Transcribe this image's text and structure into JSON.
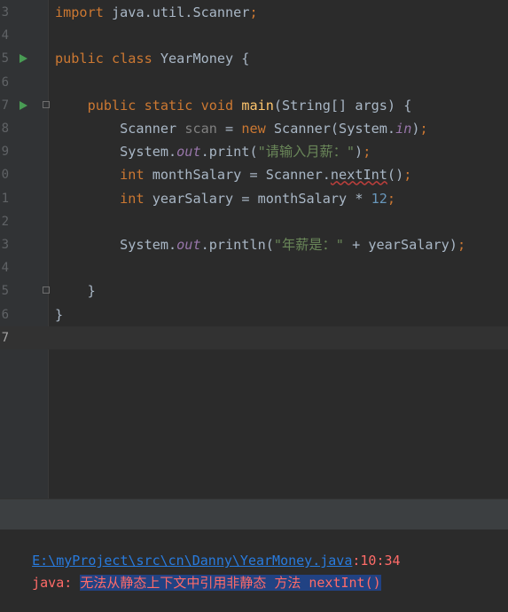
{
  "editor": {
    "lines": [
      {
        "number": "3",
        "parts": [
          [
            "kw",
            "import"
          ],
          [
            "p",
            " java.util.Scanner"
          ],
          [
            "kw",
            ";"
          ]
        ]
      },
      {
        "number": "4",
        "parts": []
      },
      {
        "number": "5",
        "run": true,
        "parts": [
          [
            "kw",
            "public class "
          ],
          [
            "p",
            "YearMoney {"
          ]
        ]
      },
      {
        "number": "6",
        "parts": []
      },
      {
        "number": "7",
        "run": true,
        "fold": true,
        "parts": [
          [
            "p",
            "    "
          ],
          [
            "kw",
            "public static void "
          ],
          [
            "fn",
            "main"
          ],
          [
            "p",
            "(String[] args) {"
          ]
        ]
      },
      {
        "number": "8",
        "parts": [
          [
            "p",
            "        Scanner "
          ],
          [
            "gray",
            "scan"
          ],
          [
            "p",
            " = "
          ],
          [
            "kw",
            "new "
          ],
          [
            "p",
            "Scanner(System."
          ],
          [
            "field",
            "in"
          ],
          [
            "p",
            ")"
          ],
          [
            "kw",
            ";"
          ]
        ]
      },
      {
        "number": "9",
        "parts": [
          [
            "p",
            "        System."
          ],
          [
            "field",
            "out"
          ],
          [
            "p",
            ".print("
          ],
          [
            "str",
            "\"请输入月薪：\""
          ],
          [
            "p",
            ")"
          ],
          [
            "kw",
            ";"
          ]
        ]
      },
      {
        "number": "0",
        "parts": [
          [
            "p",
            "        "
          ],
          [
            "kw",
            "int "
          ],
          [
            "p",
            "monthSalary = Scanner."
          ],
          [
            "typo",
            "nextInt"
          ],
          [
            "p",
            "()"
          ],
          [
            "kw",
            ";"
          ]
        ]
      },
      {
        "number": "1",
        "parts": [
          [
            "p",
            "        "
          ],
          [
            "kw",
            "int "
          ],
          [
            "p",
            "yearSalary = monthSalary * "
          ],
          [
            "num",
            "12"
          ],
          [
            "kw",
            ";"
          ]
        ]
      },
      {
        "number": "2",
        "parts": []
      },
      {
        "number": "3",
        "parts": [
          [
            "p",
            "        System."
          ],
          [
            "field",
            "out"
          ],
          [
            "p",
            ".println("
          ],
          [
            "str",
            "\"年薪是：\""
          ],
          [
            "p",
            " + yearSalary)"
          ],
          [
            "kw",
            ";"
          ]
        ]
      },
      {
        "number": "4",
        "parts": []
      },
      {
        "number": "5",
        "fold": true,
        "parts": [
          [
            "p",
            "    }"
          ]
        ]
      },
      {
        "number": "6",
        "parts": [
          [
            "p",
            "}"
          ]
        ]
      },
      {
        "number": "7",
        "current": true,
        "parts": []
      }
    ]
  },
  "console": {
    "path": "E:\\myProject\\src\\cn\\Danny\\YearMoney.java",
    "location": ":10:34",
    "error_prefix": "java: ",
    "error_message": "无法从静态上下文中引用非静态 方法 nextInt()"
  },
  "colors": {
    "background": "#2b2b2b",
    "keyword": "#cc7832",
    "string": "#6a8759",
    "number": "#6897bb",
    "field": "#9876aa",
    "method": "#ffc66d",
    "error": "#ff6b68",
    "link": "#287bde"
  },
  "icons": {
    "run": "run-gutter-icon",
    "fold": "fold-icon"
  }
}
